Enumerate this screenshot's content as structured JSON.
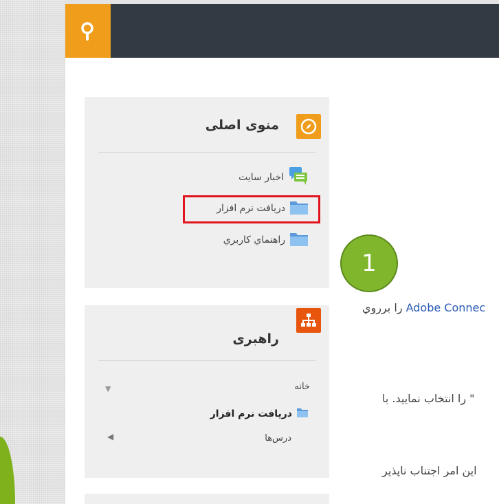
{
  "sidebar_main_menu": {
    "title": "منوی اصلی",
    "items": [
      {
        "label": "اخبار سایت",
        "icon": "chat-bubbles-icon"
      },
      {
        "label": "دریافت نرم افزار",
        "icon": "folder-icon"
      },
      {
        "label": "راهنماي كاربري",
        "icon": "folder-icon"
      }
    ]
  },
  "navigation_block": {
    "title": "راهبری",
    "home": "خانه",
    "current": "دریافت نرم افزار",
    "courses": "درس‌ها"
  },
  "annotation": {
    "step_number": "1",
    "highlight_color": "#e1141d",
    "badge_color": "#7fb62b"
  },
  "content": {
    "line1_link": "Adobe Connec",
    "line1_text": " را برروي",
    "line2": "\" را انتخاب نماييد. با",
    "line3": "اين امر اجتناب ناپذير"
  },
  "colors": {
    "topbar": "#343a43",
    "search_button": "#ef9d1b",
    "main_menu_icon": "#ef9d1b",
    "navigation_icon": "#e8560e"
  }
}
